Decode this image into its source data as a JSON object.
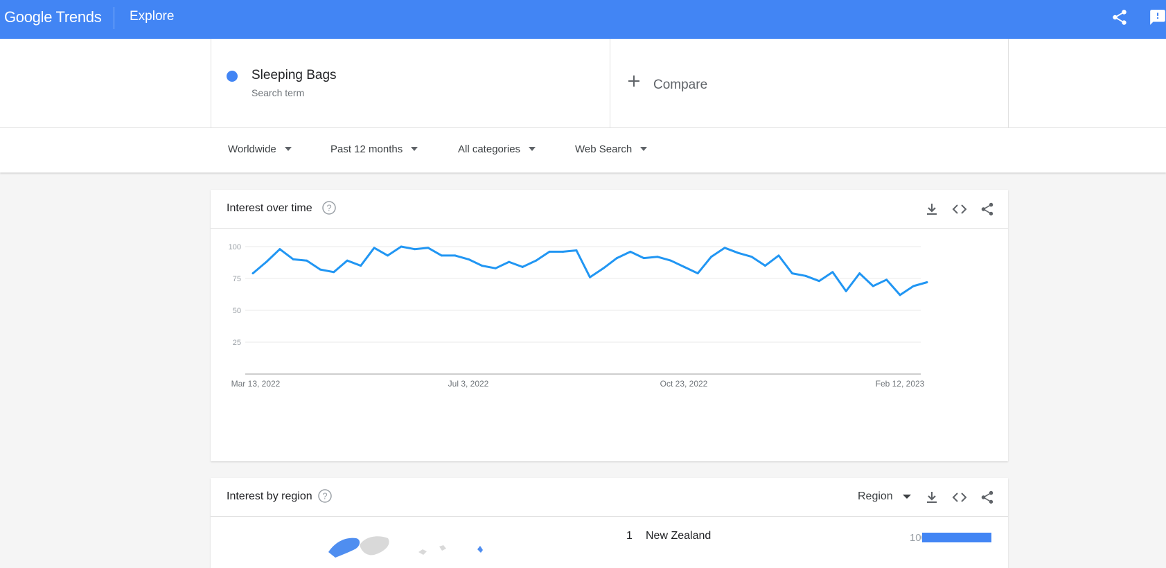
{
  "header": {
    "logo": "Google Trends",
    "page": "Explore"
  },
  "search": {
    "term": "Sleeping Bags",
    "term_type": "Search term",
    "term_color": "#4285f4",
    "compare_label": "Compare"
  },
  "filters": [
    {
      "label": "Worldwide"
    },
    {
      "label": "Past 12 months"
    },
    {
      "label": "All categories"
    },
    {
      "label": "Web Search"
    }
  ],
  "interest_over_time": {
    "title": "Interest over time",
    "actions": [
      "download-icon",
      "embed-icon",
      "share-icon"
    ]
  },
  "chart_data": {
    "type": "line",
    "x_tick_labels": [
      "Mar 13, 2022",
      "Jul 3, 2022",
      "Oct 23, 2022",
      "Feb 12, 2023"
    ],
    "y_tick_labels": [
      "100",
      "75",
      "50",
      "25"
    ],
    "ylim": [
      0,
      100
    ],
    "grid": true,
    "series": [
      {
        "color": "#2196f3",
        "values": [
          79,
          88,
          98,
          90,
          89,
          82,
          80,
          89,
          85,
          99,
          93,
          100,
          98,
          99,
          93,
          93,
          90,
          85,
          83,
          88,
          84,
          89,
          96,
          96,
          97,
          76,
          83,
          91,
          96,
          91,
          92,
          89,
          84,
          79,
          92,
          99,
          95,
          92,
          85,
          93,
          79,
          77,
          73,
          80,
          65,
          79,
          69,
          74,
          62,
          69,
          72
        ]
      }
    ]
  },
  "interest_by_region": {
    "title": "Interest by region",
    "resolution_label": "Region",
    "rows": [
      {
        "rank": "1",
        "name": "New Zealand",
        "value": "100",
        "fraction": 1.0
      }
    ]
  }
}
